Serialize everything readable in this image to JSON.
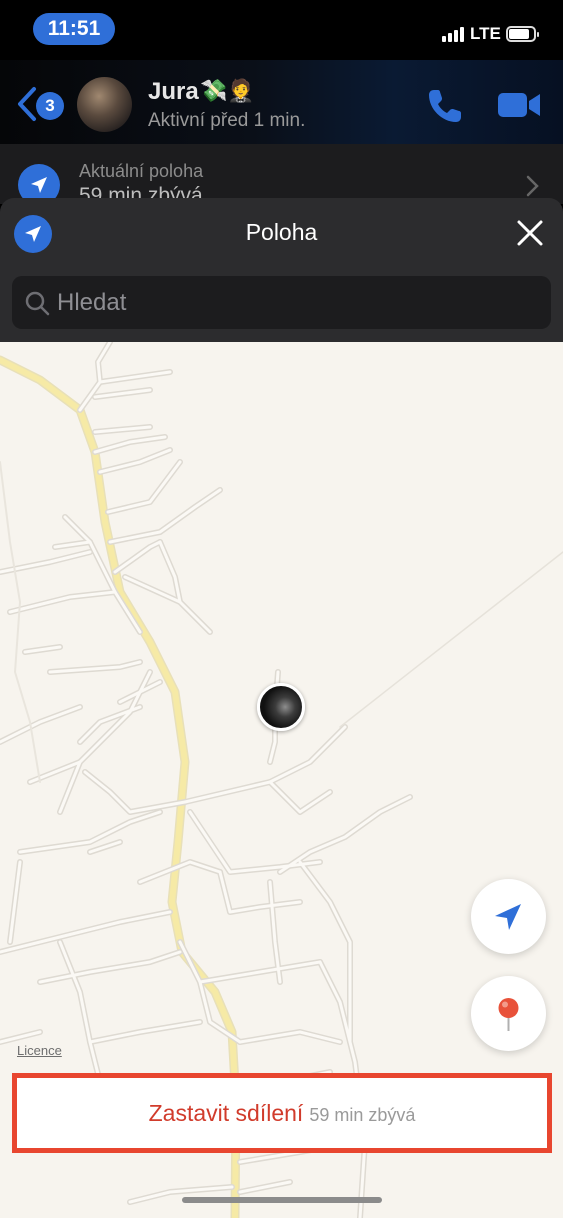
{
  "status_bar": {
    "time": "11:51",
    "network": "LTE"
  },
  "header": {
    "back_badge": "3",
    "contact_name": "Jura",
    "contact_emoji": "💸🤵",
    "contact_status": "Aktivní před 1 min.",
    "icons": [
      "back-chevron-icon",
      "phone-icon",
      "video-camera-icon"
    ]
  },
  "location_banner": {
    "title": "Aktuální poloha",
    "subtitle": "59 min zbývá"
  },
  "sheet": {
    "title": "Poloha",
    "search_placeholder": "Hledat"
  },
  "map": {
    "licence": "Licence",
    "stop_sharing_label": "Zastavit sdílení",
    "stop_sharing_remaining": "59 min zbývá"
  },
  "colors": {
    "accent_blue": "#2f6fd8",
    "stop_red": "#d13b2b",
    "highlight_border": "#e8462f",
    "map_background": "#f7f4ee",
    "main_road": "#f6eaa6"
  }
}
